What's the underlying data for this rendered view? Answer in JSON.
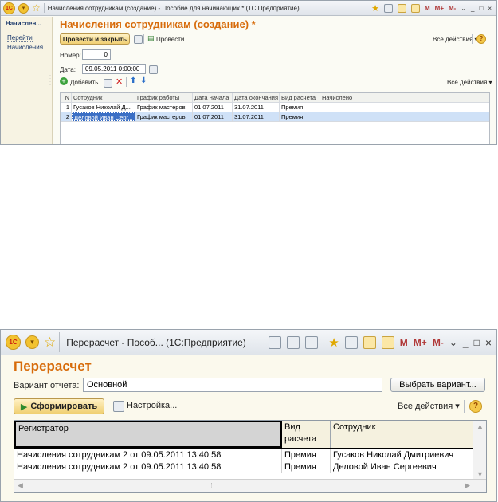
{
  "window1": {
    "title": "Начисления сотрудникам (создание) - Пособие для начинающих * (1С:Предприятие)",
    "titlebar_right": {
      "m": "M",
      "mplus": "M+",
      "mminus": "M-",
      "minimize": "_",
      "restore": "□",
      "close": "×"
    },
    "nav": {
      "active": "Начислен...",
      "goto": "Перейти",
      "item": "Начисления"
    },
    "heading": "Начисления сотрудникам (создание) *",
    "toolbar": {
      "post_close": "Провести и закрыть",
      "post": "Провести",
      "all_actions": "Все действия ▾"
    },
    "fields": {
      "number_label": "Номер:",
      "number_value": "0",
      "date_label": "Дата:",
      "date_value": "09.05.2011  0:00:00"
    },
    "table_toolbar": {
      "add": "Добавить",
      "all_actions": "Все действия ▾"
    },
    "table": {
      "columns": [
        "N",
        "Сотрудник",
        "График работы",
        "Дата начала",
        "Дата окончания",
        "Вид расчета",
        "Начислено"
      ],
      "rows": [
        [
          "1",
          "Гусаков Николай Д...",
          "График мастеров",
          "01.07.2011",
          "31.07.2011",
          "Премия",
          ""
        ],
        [
          "2",
          "Деловой Иван Серг...",
          "График мастеров",
          "01.07.2011",
          "31.07.2011",
          "Премия",
          ""
        ]
      ],
      "selected_row": 2
    }
  },
  "window2": {
    "title": "Перерасчет - Пособ... (1С:Предприятие)",
    "titlebar_right": {
      "m": "M",
      "mplus": "M+",
      "mminus": "M-",
      "minimize": "_",
      "restore": "□",
      "close": "×"
    },
    "heading": "Перерасчет",
    "variant_label": "Вариант отчета:",
    "variant_value": "Основной",
    "choose_variant": "Выбрать вариант...",
    "generate": "Сформировать",
    "settings": "Настройка...",
    "all_actions": "Все действия ▾",
    "table": {
      "columns": [
        "Регистратор",
        "Вид расчета",
        "Сотрудник"
      ],
      "rows": [
        [
          "Начисления сотрудникам 2 от 09.05.2011 13:40:58",
          "Премия",
          "Гусаков Николай Дмитриевич"
        ],
        [
          "Начисления сотрудникам 2 от 09.05.2011 13:40:58",
          "Премия",
          "Деловой Иван Сергеевич"
        ]
      ]
    }
  },
  "colors": {
    "heading": "#d76b0a",
    "selection": "#3b6fc5",
    "button_yellow": "#f0cf72"
  }
}
